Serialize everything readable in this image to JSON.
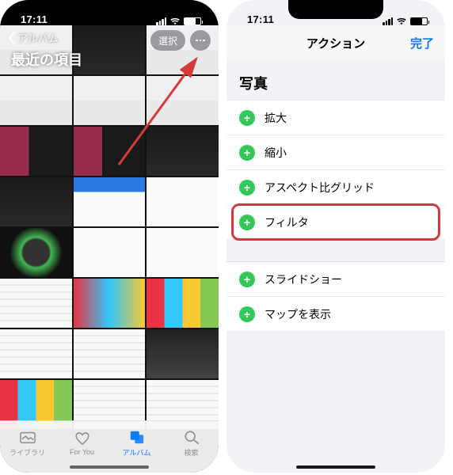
{
  "status": {
    "time": "17:11"
  },
  "left": {
    "back_label": "アルバム",
    "title": "最近の項目",
    "select_label": "選択",
    "tabs": {
      "library": "ライブラリ",
      "for_you": "For You",
      "albums": "アルバム",
      "search": "検索"
    }
  },
  "right": {
    "nav_title": "アクション",
    "done": "完了",
    "section": "写真",
    "actions": [
      {
        "label": "拡大"
      },
      {
        "label": "縮小"
      },
      {
        "label": "アスペクト比グリッド"
      },
      {
        "label": "フィルタ",
        "highlighted": true
      },
      {
        "label": "スライドショー"
      },
      {
        "label": "マップを表示"
      }
    ]
  }
}
